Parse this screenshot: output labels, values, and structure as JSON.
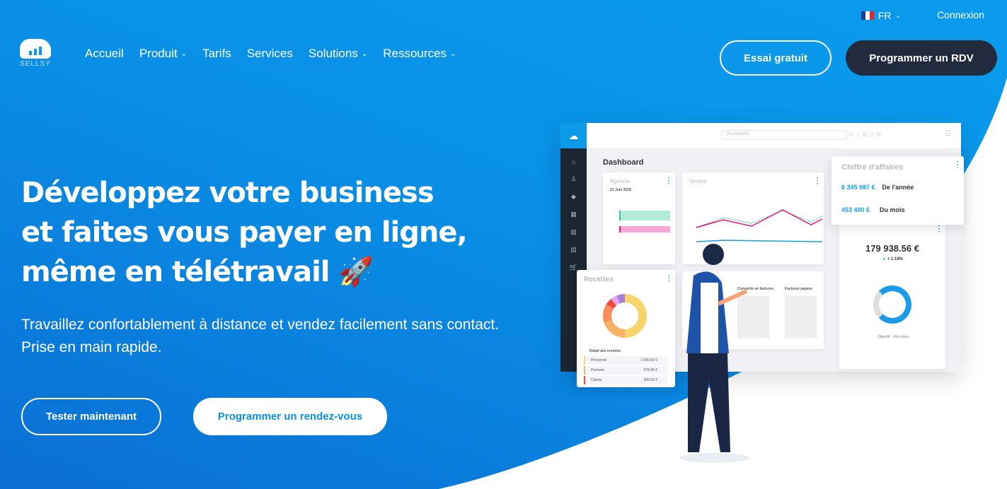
{
  "topbar": {
    "lang": "FR",
    "login": "Connexion"
  },
  "logo": {
    "text": "SELLSY"
  },
  "nav": [
    {
      "label": "Accueil",
      "dropdown": false
    },
    {
      "label": "Produit",
      "dropdown": true
    },
    {
      "label": "Tarifs",
      "dropdown": false
    },
    {
      "label": "Services",
      "dropdown": false
    },
    {
      "label": "Solutions",
      "dropdown": true
    },
    {
      "label": "Ressources",
      "dropdown": true
    }
  ],
  "header_buttons": {
    "trial": "Essai gratuit",
    "meeting": "Programmer un RDV"
  },
  "hero": {
    "title_lines": [
      "Développez votre business",
      "et faites vous payer en ligne,",
      "même en télétravail 🚀"
    ],
    "subtitle": "Travaillez confortablement à distance et vendez facilement sans contact. Prise en main rapide.",
    "cta_primary": "Tester maintenant",
    "cta_secondary": "Programmer un rendez-vous"
  },
  "dashboard": {
    "search_placeholder": "Rechercher",
    "title": "Dashboard",
    "agenda": {
      "title": "Agenda",
      "date": "21 Juin 2018"
    },
    "ventes": {
      "title": "Ventes"
    },
    "ca": {
      "title": "Chiffre d'affaires",
      "rows": [
        {
          "value": "6 345 987 €",
          "label": "De l'année"
        },
        {
          "value": "453 400 €",
          "label": "Du mois"
        }
      ]
    },
    "kpi": {
      "value": "179 938.56 €",
      "delta": "+ 1.18%"
    },
    "recettes": {
      "title": "Recettes",
      "detail": "Détail des recettes",
      "rows": [
        {
          "label": "Personnel",
          "value": "2 000.00 €"
        },
        {
          "label": "Partures",
          "value": "578.95 €"
        },
        {
          "label": "Clients",
          "value": "200.00 €"
        }
      ]
    },
    "factures": {
      "converted": "Convertis en factures",
      "paid": "Factures payées"
    },
    "legend": [
      "Objectif",
      "En cours"
    ]
  },
  "colors": {
    "brand": "#0a9ae8",
    "dark_button": "#222a3d"
  }
}
